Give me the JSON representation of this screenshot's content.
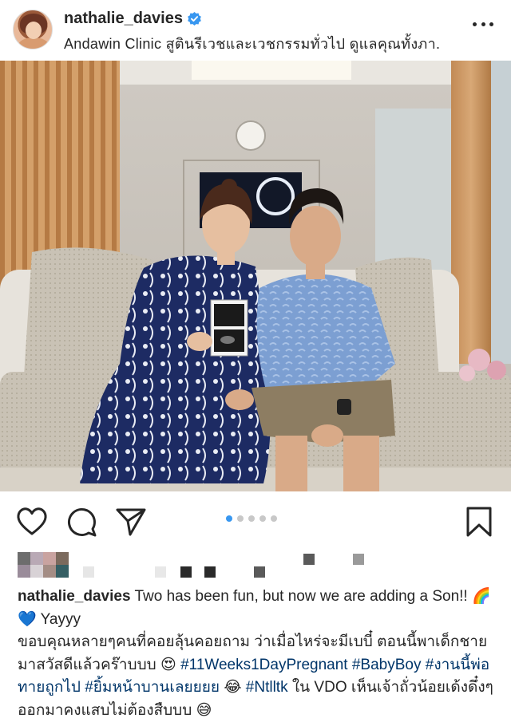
{
  "post": {
    "username": "nathalie_davies",
    "location": "Andawin Clinic สูตินรีเวชและเวชกรรมทั่วไป ดูแลคุณทั้งภา...",
    "verified": true
  },
  "icons": {
    "more": "more-options-icon",
    "like": "heart-icon",
    "comment": "comment-icon",
    "share": "send-icon",
    "save": "bookmark-icon",
    "verified": "verified-badge-icon"
  },
  "carousel": {
    "total": 5,
    "active": 1
  },
  "caption": {
    "username": "nathalie_davies",
    "line1": "Two has been fun, but now we are adding a Son!!",
    "emoji_rainbow": "🌈",
    "emoji_heart": "💙",
    "line1_tail": "Yayyy",
    "line2": "ขอบคุณหลายๆคนที่คอยลุ้นคอยถาม ว่าเมื่อไหร่จะมีเบบี๋ ตอนนี้พาเด็กชายมาสวัสดีแล้วคร๊าบบบ",
    "emoji_hearteyes": "😍",
    "tag1": "#11Weeks1DayPregnant",
    "tag2": "#BabyBoy",
    "tag3": "#งานนี้พ่อทายถูกไป",
    "tag4": "#ยิ้มหน้าบานเลยยยย",
    "emoji_laugh": "😂",
    "tag5": "#Ntlltk",
    "line3": "ใน VDO เห็นเจ้าถั่วน้อยเด้งดึ๋งๆ ออกมาคงแสบไม่ต้องสืบบบ",
    "emoji_sweat": "😅"
  },
  "colors": {
    "accent": "#3897f0",
    "hashtag": "#003569",
    "text": "#262626"
  }
}
